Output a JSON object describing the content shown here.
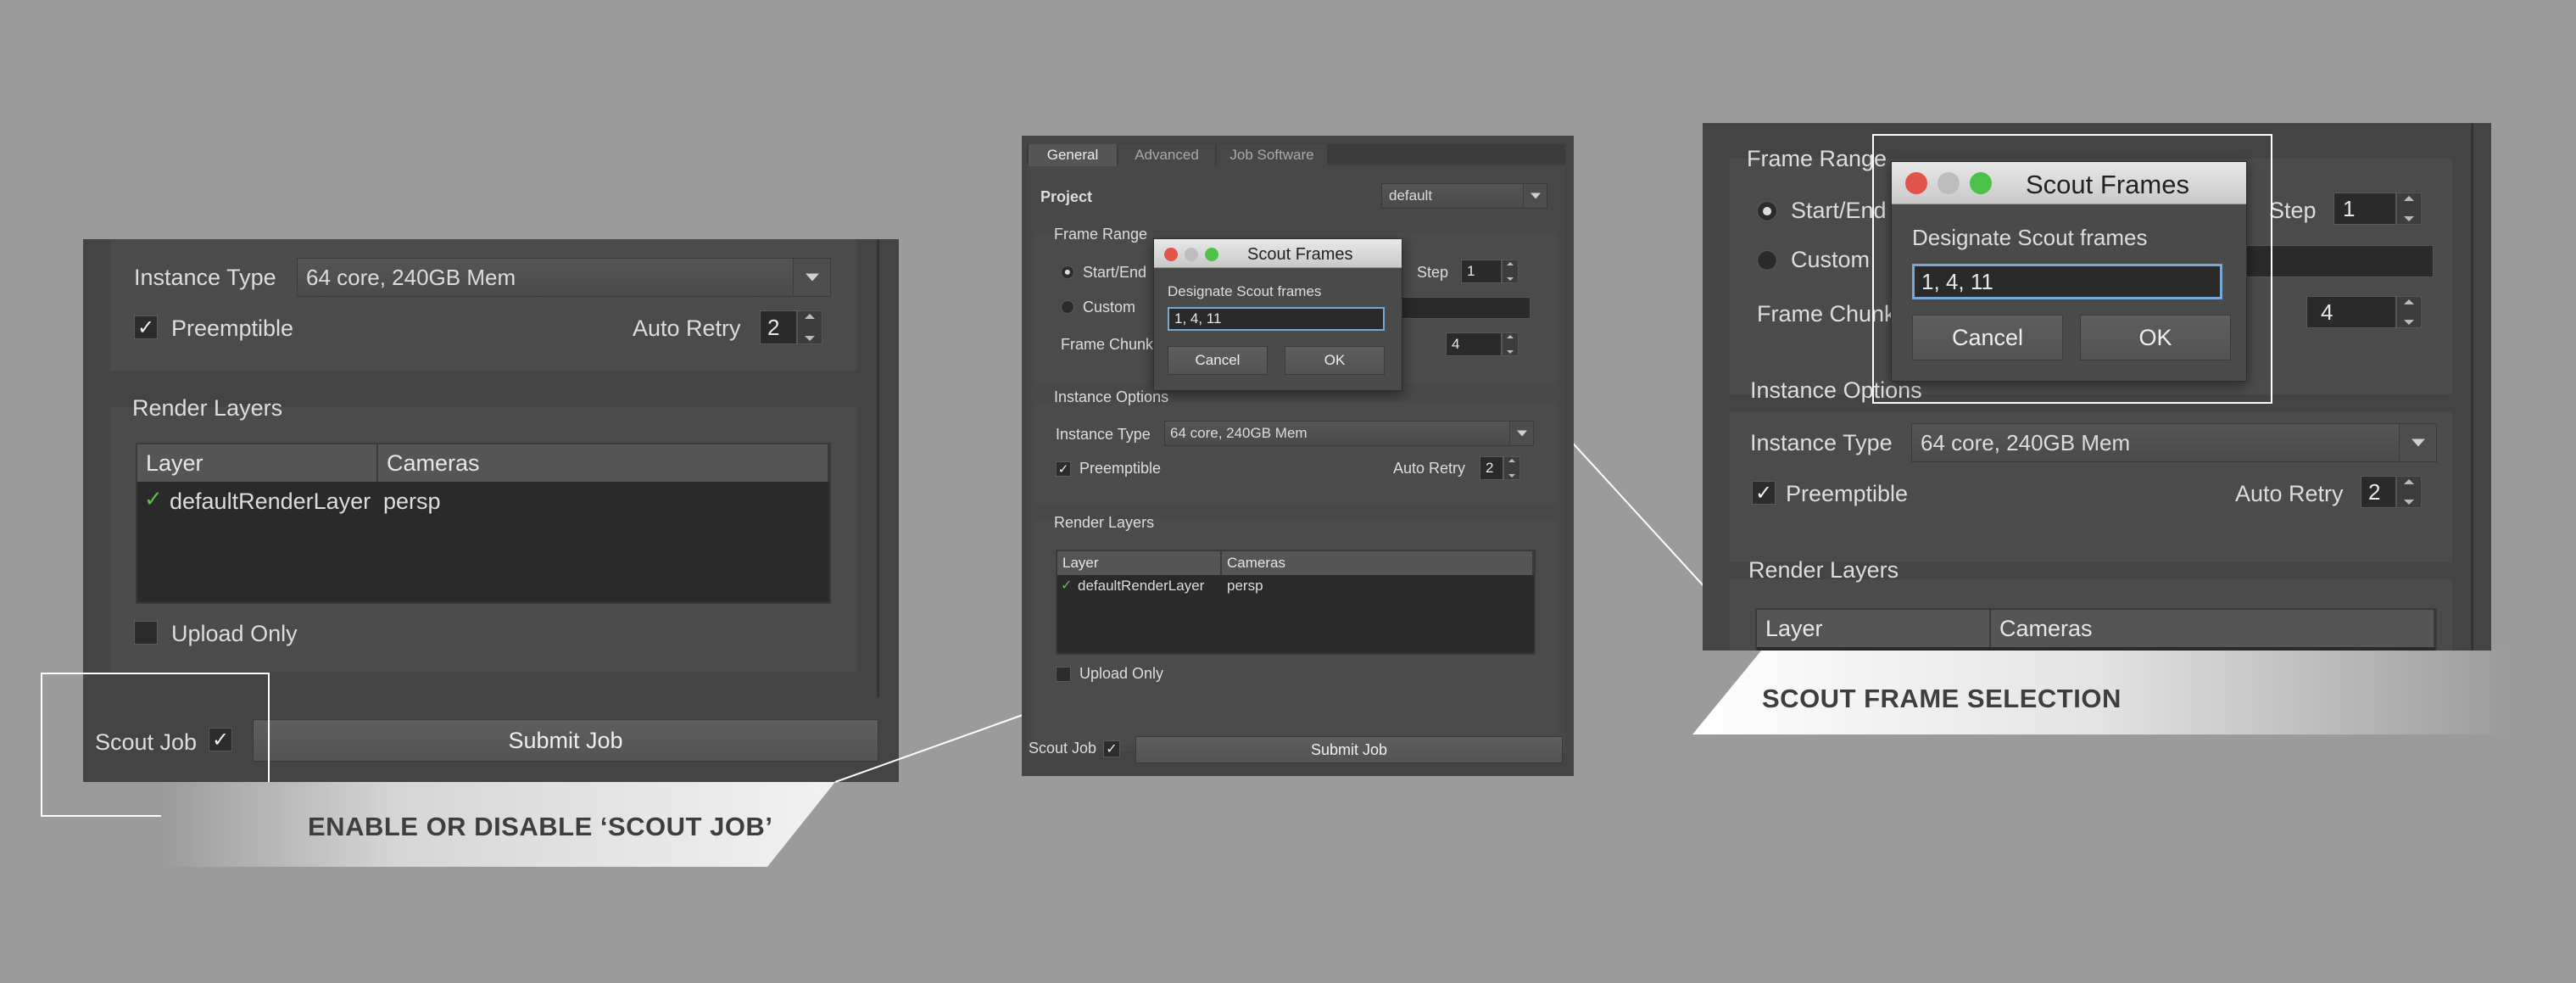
{
  "colors": {
    "background": "#9b9b9b",
    "panel": "#444444",
    "group": "#4b4b4b",
    "check_green": "#5fbf4a",
    "traffic_red": "#e2544a",
    "traffic_gray": "#bdbdbd",
    "traffic_green": "#4cc24a"
  },
  "left_panel": {
    "instance_type_label": "Instance Type",
    "instance_type_value": "64 core, 240GB Mem",
    "preemptible_label": "Preemptible",
    "auto_retry_label": "Auto Retry",
    "auto_retry_value": "2",
    "render_layers_title": "Render Layers",
    "table_headers": [
      "Layer",
      "Cameras"
    ],
    "table_rows": [
      {
        "check": "✓",
        "layer": "defaultRenderLayer",
        "camera": "persp"
      }
    ],
    "upload_only_label": "Upload Only",
    "scout_job_label": "Scout Job",
    "submit_label": "Submit Job"
  },
  "left_banner": "ENABLE OR DISABLE ‘SCOUT JOB’",
  "middle_panel": {
    "tabs": [
      "General",
      "Advanced",
      "Job Software"
    ],
    "project_label": "Project",
    "project_value": "default",
    "frame_range_title": "Frame Range",
    "start_end_label": "Start/End",
    "step_label": "Step",
    "step_value": "1",
    "custom_label": "Custom",
    "frame_chunk_label": "Frame Chunk",
    "frame_chunk_value": "4",
    "instance_options_title": "Instance Options",
    "instance_type_label": "Instance Type",
    "instance_type_value": "64 core, 240GB Mem",
    "preemptible_label": "Preemptible",
    "auto_retry_label": "Auto Retry",
    "auto_retry_value": "2",
    "render_layers_title": "Render Layers",
    "table_headers": [
      "Layer",
      "Cameras"
    ],
    "table_rows": [
      {
        "check": "✓",
        "layer": "defaultRenderLayer",
        "camera": "persp"
      }
    ],
    "upload_only_label": "Upload Only",
    "scout_job_label": "Scout Job",
    "submit_label": "Submit Job",
    "dialog": {
      "title": "Scout Frames",
      "prompt": "Designate Scout frames",
      "value": "1, 4, 11",
      "cancel": "Cancel",
      "ok": "OK"
    }
  },
  "right_panel": {
    "frame_range_title": "Frame Range",
    "start_end_label": "Start/End",
    "step_label": "Step",
    "step_value": "1",
    "custom_label": "Custom",
    "frame_chunk_label": "Frame Chunk",
    "frame_chunk_value": "4",
    "instance_options_title": "Instance Options",
    "instance_type_label": "Instance Type",
    "instance_type_value": "64 core, 240GB Mem",
    "preemptible_label": "Preemptible",
    "auto_retry_label": "Auto Retry",
    "auto_retry_value": "2",
    "render_layers_title": "Render Layers",
    "table_headers": [
      "Layer",
      "Cameras"
    ],
    "dialog": {
      "title": "Scout Frames",
      "prompt": "Designate Scout frames",
      "value": "1, 4, 11",
      "cancel": "Cancel",
      "ok": "OK"
    }
  },
  "right_banner": "SCOUT FRAME SELECTION",
  "icons": {
    "checkmark": "✓",
    "dropdown": "dropdown-arrow-icon"
  }
}
